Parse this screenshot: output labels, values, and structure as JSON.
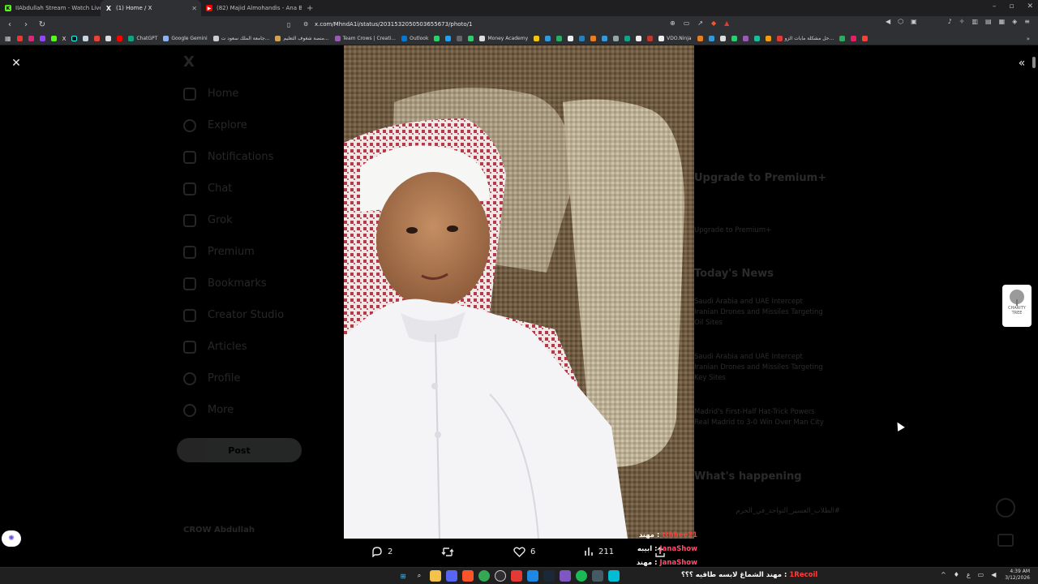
{
  "browser": {
    "tabs": [
      {
        "title": "IIAbdullah Stream - Watch Live on K",
        "favicon_color": "#53fc18",
        "favicon": "K",
        "active": false
      },
      {
        "title": "(1) Home / X",
        "favicon_color": "#ffffff",
        "favicon": "X",
        "active": true
      },
      {
        "title": "(82) Majid Almohandis - Ana Bah",
        "favicon_color": "#ff0000",
        "favicon": "▶",
        "active": false
      }
    ],
    "new_tab": "+",
    "url": "x.com/MhndA1i/status/2031532050503655673/photo/1",
    "bookmarks": [
      {
        "label": "ChatGPT",
        "color": "#10a37f"
      },
      {
        "label": "Google Gemini",
        "color": "#8ab4f8"
      },
      {
        "label": "جامعة الملك سعود ت...",
        "color": "#cccccc"
      },
      {
        "label": "منصة شغوف التعليم...",
        "color": "#d4a24c"
      },
      {
        "label": "Team Crows | Creati...",
        "color": "#9b59b6"
      },
      {
        "label": "Outlook",
        "color": "#0078d4"
      },
      {
        "label": "Money Academy",
        "color": "#dddddd"
      },
      {
        "label": "VDO.Ninja",
        "color": "#eeeeee"
      },
      {
        "label": "حل مشكلة مابات الزو...",
        "color": "#e53935"
      }
    ]
  },
  "x_page": {
    "nav": [
      "Home",
      "Explore",
      "Notifications",
      "Chat",
      "Grok",
      "Premium",
      "Bookmarks",
      "Creator Studio",
      "Articles",
      "Profile",
      "More"
    ],
    "post_button": "Post",
    "user": "CROW Abdullah",
    "right_sidebar": {
      "premium_heading": "Upgrade to Premium+",
      "premium_button": "Upgrade to Premium+",
      "news_heading": "Today's News",
      "news": [
        "Saudi Arabia and UAE Intercept Iranian Drones and Missiles Targeting Oil Sites",
        "Saudi Arabia and UAE Intercept Iranian Drones and Missiles Targeting Key Sites",
        "Madrid's First-Half Hat-Trick Powers Real Madrid to 3-0 Win Over Man City"
      ],
      "happening_heading": "What's happening",
      "happening": [
        "#الطلاب_العسير_التواجد_في_الحرم"
      ]
    }
  },
  "viewer": {
    "close_label": "✕",
    "toggle_label": "«",
    "charity_label": "CHARITY TREE",
    "stats": {
      "replies": "2",
      "reposts": "",
      "likes": "6",
      "views": "211"
    }
  },
  "overlay_chat": [
    {
      "user": "tthhee21",
      "message": "مهند"
    },
    {
      "user": "JanaShow",
      "message": "ابيبه"
    },
    {
      "user": "JanaShow",
      "message": "مهند"
    }
  ],
  "taskbar": {
    "chat": {
      "user": "1Recoil",
      "message": "مهند الشماغ لابسه طاقيه ؟؟؟"
    },
    "time": "4:39 AM",
    "date": "3/12/2026"
  }
}
